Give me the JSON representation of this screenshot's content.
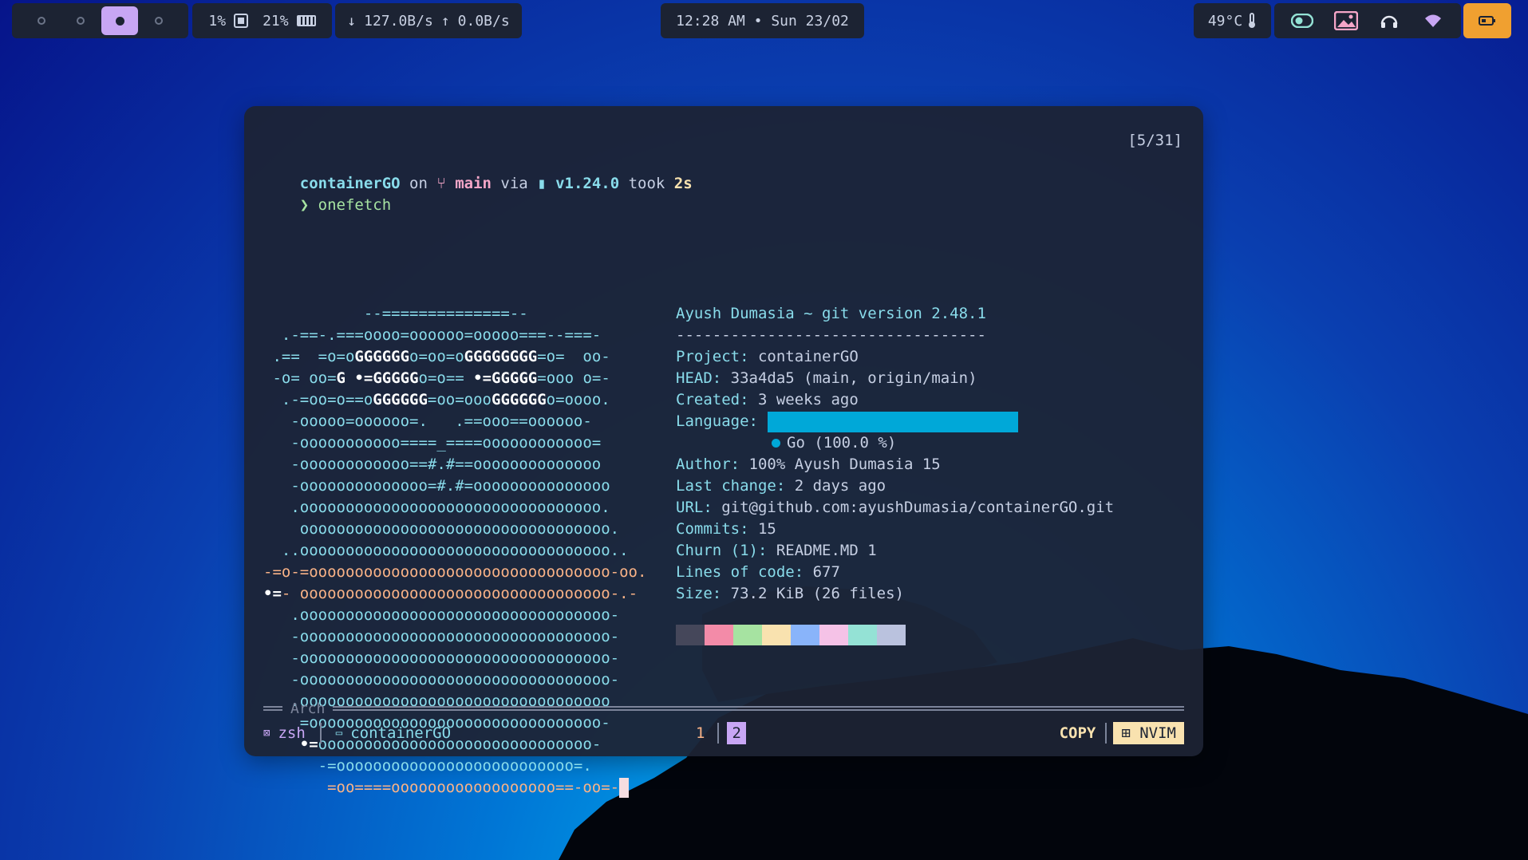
{
  "topbar": {
    "workspaces": [
      {
        "id": "1",
        "active": false
      },
      {
        "id": "2",
        "active": false
      },
      {
        "id": "3",
        "active": true
      },
      {
        "id": "4",
        "active": false
      }
    ],
    "cpu": "1%",
    "ram": "21%",
    "net_down": "127.0B/s",
    "net_up": "0.0B/s",
    "clock": "12:28 AM • Sun 23/02",
    "temperature": "49°C",
    "icons": [
      "toggle-icon",
      "wallpaper-icon",
      "headphones-icon",
      "wifi-icon"
    ],
    "battery_icon": "battery-icon"
  },
  "terminal": {
    "counter": "[5/31]",
    "prompt": {
      "dir": "containerGO",
      "on": " on ",
      "branch_icon": "",
      "branch": "main",
      "via": " via ",
      "go_icon": "",
      "version": "v1.24.0",
      "took": " took ",
      "duration": "2s",
      "symbol": "❯",
      "command": "onefetch"
    },
    "ascii_art": [
      "           --==============--",
      "  .-==-.===oooo=oooooo=ooooo===--===-",
      " .==  =o=oGGGGGGo=oo=oGGGGGGGG=o=  oo-",
      " -o= oo=G •=GGGGGo=o== •=GGGGG=ooo o=-",
      "  .-=oo=o==oGGGGGG=oo=oooGGGGGGo=oooo.",
      "   -ooooo=oooooo=.   .==ooo==oooooo-",
      "   -ooooooooooo====_====oooooooooooo=",
      "   -oooooooooooo==#.#==oooooooooooooo",
      "   -oooooooooooooo=#.#=ooooooooooooooo",
      "   .ooooooooooooooooooooooooooooooooo.",
      "    oooooooooooooooooooooooooooooooooo.",
      "  ..oooooooooooooooooooooooooooooooooo..",
      "-=o-=ooooooooooooooooooooooooooooooooo-oo.",
      "•=- oooooooooooooooooooooooooooooooooo-.-",
      "   .oooooooooooooooooooooooooooooooooo-",
      "   -oooooooooooooooooooooooooooooooooo-",
      "   -oooooooooooooooooooooooooooooooooo-",
      "   -oooooooooooooooooooooooooooooooooo-",
      "   .oooooooooooooooooooooooooooooooooo",
      "    =oooooooooooooooooooooooooooooooo-",
      "    •=oooooooooooooooooooooooooooooo-",
      "      -=oooooooooooooooooooooooooo=.",
      "       =oo====oooooooooooooooooo==-oo=-"
    ],
    "info": {
      "header": "Ayush Dumasia ~ git version 2.48.1",
      "divider": "----------------------------------",
      "project_label": "Project:",
      "project_value": "containerGO",
      "head_label": "HEAD:",
      "head_value": "33a4da5 (main, origin/main)",
      "created_label": "Created:",
      "created_value": "3 weeks ago",
      "language_label": "Language:",
      "language_value": "Go (100.0 %)",
      "language_fraction": 1.0,
      "author_label": "Author:",
      "author_value": "100% Ayush Dumasia 15",
      "last_change_label": "Last change:",
      "last_change_value": "2 days ago",
      "url_label": "URL:",
      "url_value": "git@github.com:ayushDumasia/containerGO.git",
      "commits_label": "Commits:",
      "commits_value": "15",
      "churn_label": "Churn (1):",
      "churn_value": "README.MD 1",
      "loc_label": "Lines of code:",
      "loc_value": "677",
      "size_label": "Size:",
      "size_value": "73.2 KiB (26 files)"
    },
    "palette": [
      "#45475a",
      "#f38ba8",
      "#a6e3a1",
      "#f9e2af",
      "#89b4fa",
      "#f5c2e7",
      "#94e2d5",
      "#bac2de"
    ]
  },
  "statusline": {
    "session": "Arch",
    "shell": "zsh",
    "cwd": "containerGO",
    "tabs": [
      "1",
      "2"
    ],
    "active_tab": "2",
    "mode": "COPY",
    "editor": "NVIM"
  }
}
